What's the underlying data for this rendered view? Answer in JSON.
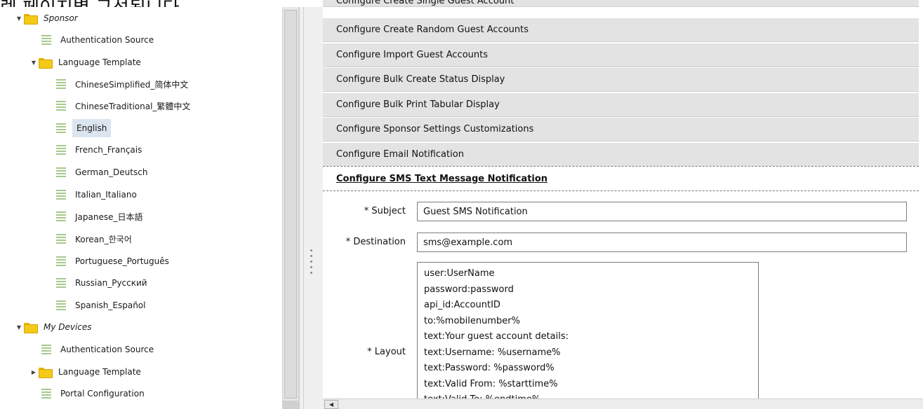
{
  "caption": "렛 페이지별 구성됩니다.",
  "tree": [
    {
      "label": "Sponsor",
      "type": "folder",
      "indent": 0,
      "expanded": true,
      "italic": true
    },
    {
      "label": "Authentication Source",
      "type": "doc",
      "indent": 1
    },
    {
      "label": "Language Template",
      "type": "folder",
      "indent": 1,
      "expanded": true
    },
    {
      "label": "ChineseSimplified_简体中文",
      "type": "doc",
      "indent": 2
    },
    {
      "label": "ChineseTraditional_繁體中文",
      "type": "doc",
      "indent": 2
    },
    {
      "label": "English",
      "type": "doc",
      "indent": 2,
      "selected": true
    },
    {
      "label": "French_Français",
      "type": "doc",
      "indent": 2
    },
    {
      "label": "German_Deutsch",
      "type": "doc",
      "indent": 2
    },
    {
      "label": "Italian_Italiano",
      "type": "doc",
      "indent": 2
    },
    {
      "label": "Japanese_日本語",
      "type": "doc",
      "indent": 2
    },
    {
      "label": "Korean_한국어",
      "type": "doc",
      "indent": 2
    },
    {
      "label": "Portuguese_Português",
      "type": "doc",
      "indent": 2
    },
    {
      "label": "Russian_Русский",
      "type": "doc",
      "indent": 2
    },
    {
      "label": "Spanish_Español",
      "type": "doc",
      "indent": 2
    },
    {
      "label": "My Devices",
      "type": "folder",
      "indent": 0,
      "expanded": true,
      "italic": true
    },
    {
      "label": "Authentication Source",
      "type": "doc",
      "indent": 1
    },
    {
      "label": "Language Template",
      "type": "folder",
      "indent": 1,
      "expanded": false
    },
    {
      "label": "Portal Configuration",
      "type": "doc",
      "indent": 1
    }
  ],
  "accordion": {
    "cut_item": "Configure Create Single Guest Account",
    "items": [
      "Configure Create Random Guest Accounts",
      "Configure Import Guest Accounts",
      "Configure Bulk Create Status Display",
      "Configure Bulk Print Tabular Display",
      "Configure Sponsor Settings Customizations",
      "Configure Email Notification"
    ],
    "active": "Configure SMS Text Message Notification"
  },
  "form": {
    "subject_label": "* Subject",
    "subject_value": "Guest SMS Notification",
    "destination_label": "* Destination",
    "destination_value": "sms@example.com",
    "layout_label": "* Layout",
    "layout_lines": [
      "user:UserName",
      "password:password",
      "api_id:AccountID",
      "to:%mobilenumber%",
      "text:Your guest account details:",
      "text:Username: %username%",
      "text:Password: %password%",
      "text:Valid From: %starttime%",
      "text:Valid To: %endtime%"
    ]
  },
  "icons": {
    "folder": "folder-icon",
    "doc": "document-icon",
    "expand": "triangle-down-icon",
    "collapse": "triangle-right-icon",
    "scroll_left": "arrow-left-icon"
  },
  "colors": {
    "folder": "#f5c918",
    "header_bg": "#e3e3e3",
    "selection": "#dbe5ef",
    "doc_lines": "#a6c98b"
  }
}
